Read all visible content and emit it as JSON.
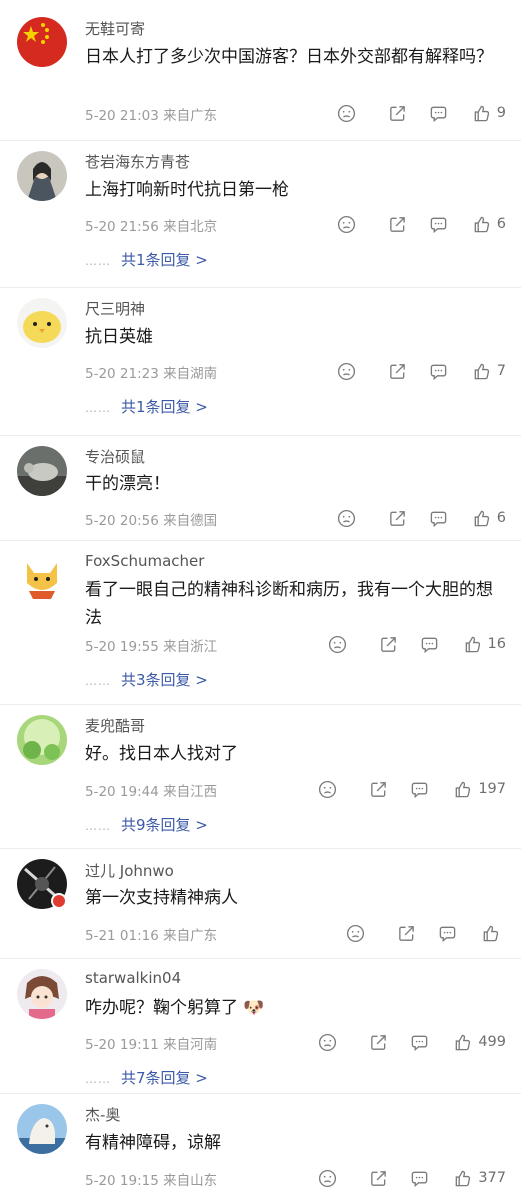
{
  "comments": [
    {
      "user": "无鞋可寄",
      "text": "日本人打了多少次中国游客？日本外交部都有解释吗？",
      "time": "5-20 21:03",
      "location": "来自广东",
      "likes": "9",
      "replies": ""
    },
    {
      "user": "苍岩海东方青苍",
      "text": "上海打响新时代抗日第一枪",
      "time": "5-20 21:56",
      "location": "来自北京",
      "likes": "6",
      "replies": "共1条回复 >"
    },
    {
      "user": "尺三明神",
      "text": "抗日英雄",
      "time": "5-20 21:23",
      "location": "来自湖南",
      "likes": "7",
      "replies": "共1条回复 >"
    },
    {
      "user": "专治硕鼠",
      "text": "干的漂亮！",
      "time": "5-20 20:56",
      "location": "来自德国",
      "likes": "6",
      "replies": ""
    },
    {
      "user": "FoxSchumacher",
      "text": "看了一眼自己的精神科诊断和病历，我有一个大胆的想法",
      "time": "5-20 19:55",
      "location": "来自浙江",
      "likes": "16",
      "replies": "共3条回复 >"
    },
    {
      "user": "麦兜酷哥",
      "text": "好。找日本人找对了",
      "time": "5-20 19:44",
      "location": "来自江西",
      "likes": "197",
      "replies": "共9条回复 >"
    },
    {
      "user": "过儿 Johnwo",
      "text": "第一次支持精神病人",
      "time": "5-21 01:16",
      "location": "来自广东",
      "likes": "",
      "replies": ""
    },
    {
      "user": "starwalkin04",
      "text": "咋办呢？鞠个躬算了",
      "emoji": "🐶",
      "time": "5-20 19:11",
      "location": "来自河南",
      "likes": "499",
      "replies": "共7条回复 >"
    },
    {
      "user": "杰-奥",
      "text": "有精神障碍，谅解",
      "time": "5-20 19:15",
      "location": "来自山东",
      "likes": "377",
      "replies": ""
    }
  ],
  "reply_dots": "……",
  "colors": {
    "link": "#3c5aa8",
    "meta": "#9a9a9a",
    "divider": "#ececec"
  },
  "icons": [
    "dislike-icon",
    "share-icon",
    "reply-icon",
    "like-icon"
  ]
}
